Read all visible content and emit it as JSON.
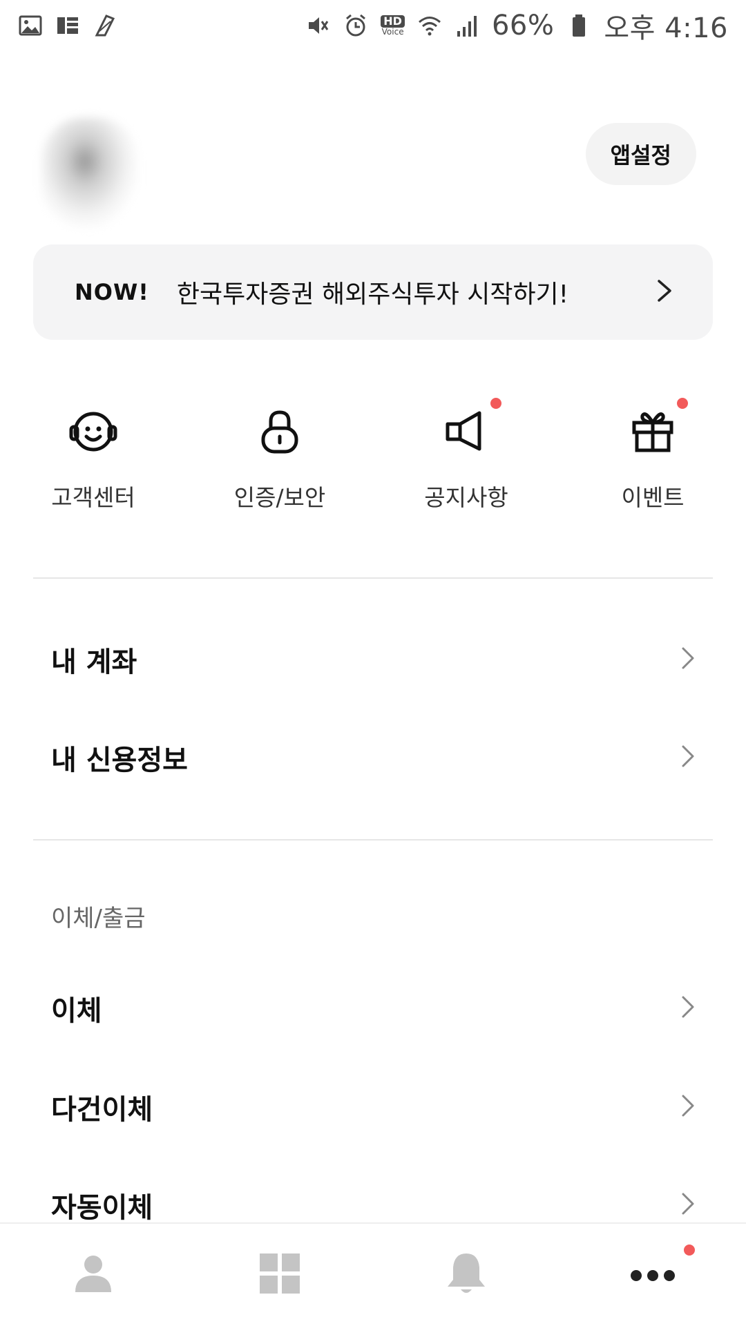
{
  "status_bar": {
    "battery": "66%",
    "time": "오후 4:16",
    "hd": "HD",
    "voice": "Voice"
  },
  "profile": {
    "app_settings_label": "앱설정"
  },
  "banner": {
    "tag": "NOW!",
    "message": "한국투자증권 해외주식투자 시작하기!"
  },
  "quick_menu": [
    {
      "label": "고객센터",
      "icon": "headset-icon",
      "badge": false
    },
    {
      "label": "인증/보안",
      "icon": "lock-icon",
      "badge": false
    },
    {
      "label": "공지사항",
      "icon": "megaphone-icon",
      "badge": true
    },
    {
      "label": "이벤트",
      "icon": "gift-icon",
      "badge": true
    }
  ],
  "account_section": {
    "items": [
      {
        "label": "내 계좌"
      },
      {
        "label": "내 신용정보"
      }
    ]
  },
  "transfer_section": {
    "title": "이체/출금",
    "items": [
      {
        "label": "이체"
      },
      {
        "label": "다건이체"
      },
      {
        "label": "자동이체"
      }
    ]
  },
  "bottom_nav": [
    {
      "icon": "person-icon",
      "active": false
    },
    {
      "icon": "grid-icon",
      "active": false
    },
    {
      "icon": "bell-icon",
      "active": false
    },
    {
      "icon": "more-icon",
      "active": true,
      "badge": true
    }
  ],
  "colors": {
    "badge": "#f25a5a",
    "banner_bg": "#f4f4f5",
    "nav_inactive": "#c4c4c4",
    "nav_active": "#222222"
  }
}
